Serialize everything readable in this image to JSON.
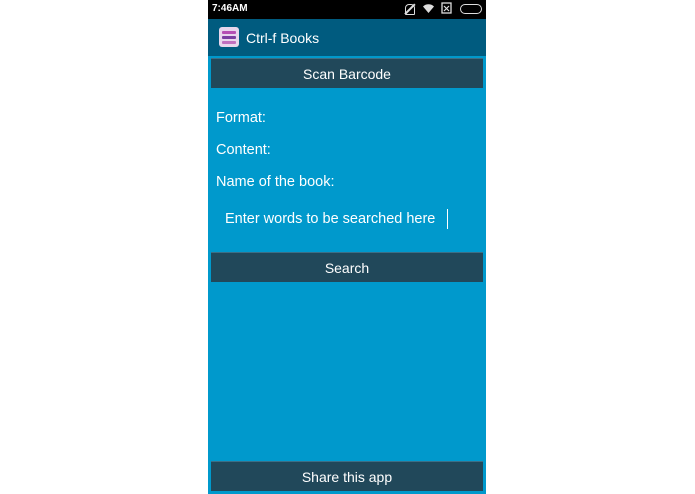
{
  "status_bar": {
    "time": "7:46AM",
    "icons": [
      "mute-icon",
      "wifi-icon",
      "sim-icon",
      "battery-icon"
    ]
  },
  "app_bar": {
    "title": "Ctrl-f Books",
    "icon": "app-books-icon"
  },
  "main": {
    "scan_button_label": "Scan Barcode",
    "format_label": "Format:",
    "content_label": "Content:",
    "book_name_label": "Name of the book:",
    "search_input_value": "Enter words to be searched here",
    "search_button_label": "Search",
    "share_button_label": "Share this app"
  },
  "colors": {
    "status_bar": "#000000",
    "app_bar": "#005b7f",
    "background": "#0099cc",
    "button": "#21485a",
    "text": "#ffffff"
  }
}
